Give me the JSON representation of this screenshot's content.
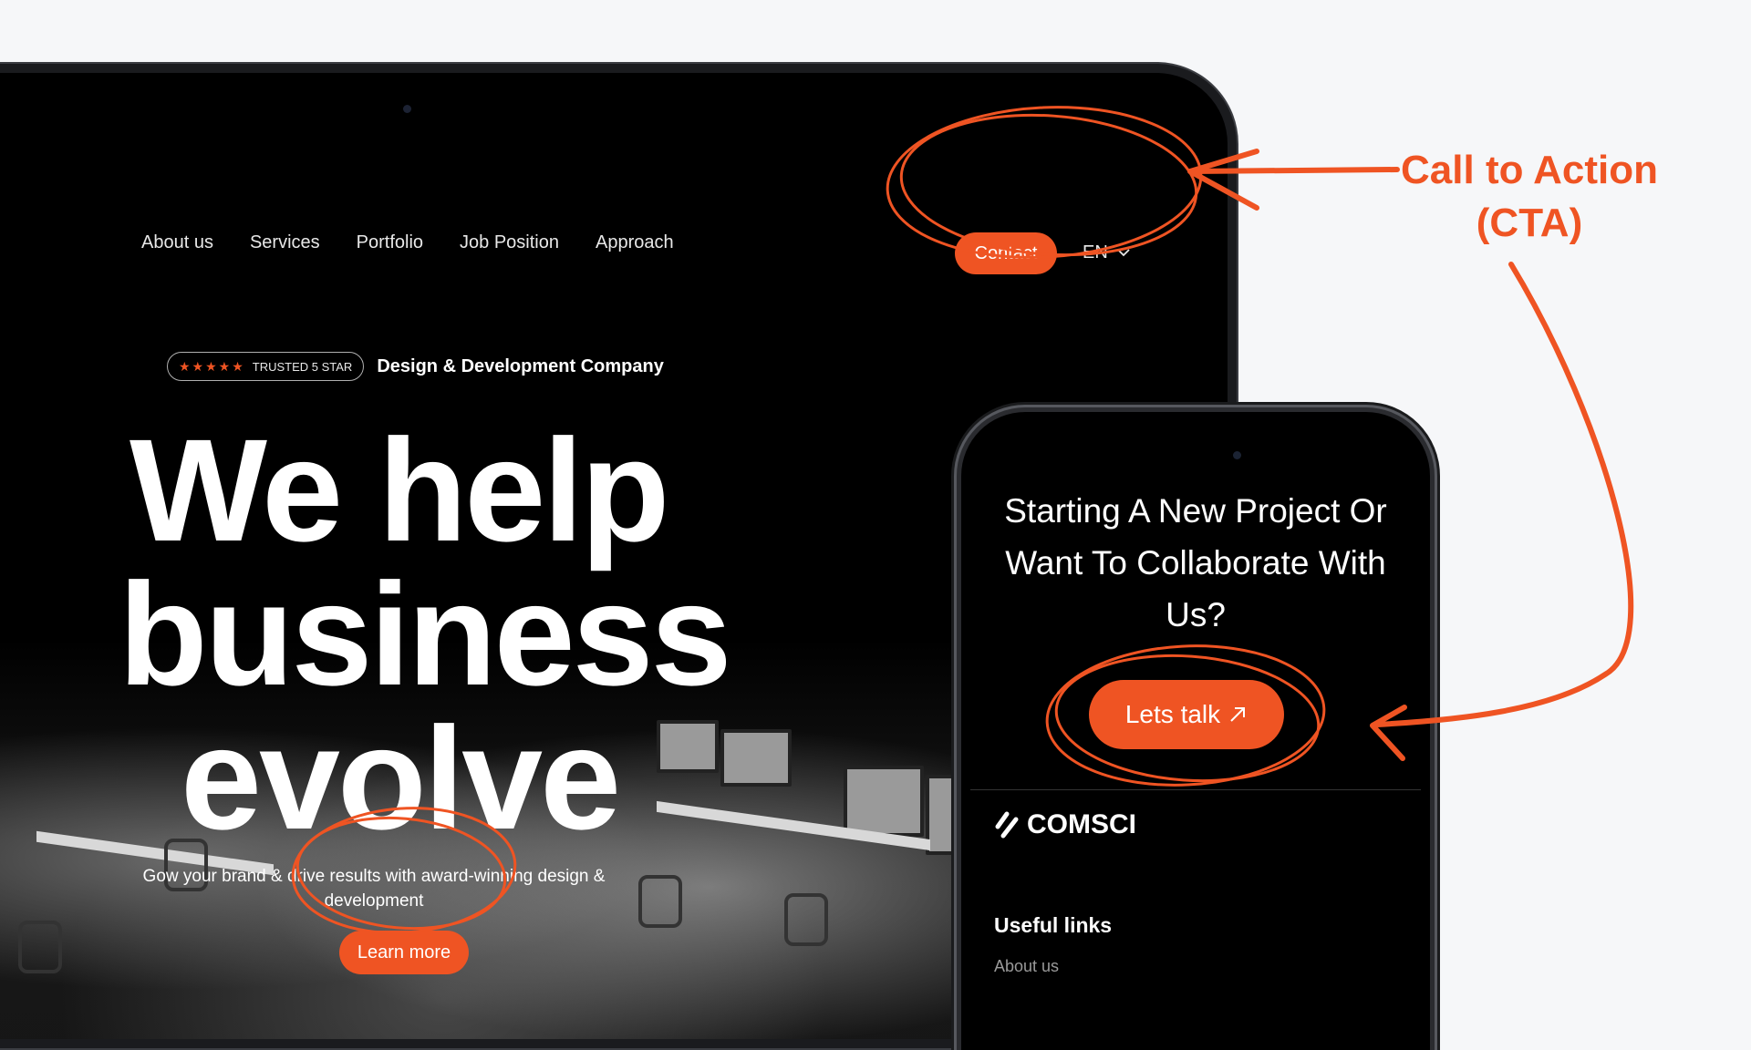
{
  "nav": {
    "items": [
      "About us",
      "Services",
      "Portfolio",
      "Job Position",
      "Approach"
    ]
  },
  "header": {
    "contact_label": "Contact",
    "language": "EN"
  },
  "badge": {
    "stars": "★★★★★",
    "trusted_label": "TRUSTED 5 STAR",
    "company_label": "Design & Development Company"
  },
  "hero": {
    "lines": [
      "We help",
      "business",
      "evolve"
    ],
    "subtitle": "Gow your brand & drive results with award-winning design & development",
    "learn_more_label": "Learn more"
  },
  "phone": {
    "heading": "Starting A New Project Or Want To Collaborate With Us?",
    "cta_label": "Lets talk",
    "logo_text": "COMSCI",
    "useful_links_title": "Useful links",
    "links": [
      "About us"
    ]
  },
  "annotation": {
    "line1": "Call to Action",
    "line2": "(CTA)"
  },
  "colors": {
    "accent": "#ef5423",
    "background": "#f6f7f9",
    "screen": "#000000"
  },
  "icons": [
    "chevron-down-icon",
    "arrow-up-right-icon",
    "comsci-logo-icon"
  ]
}
